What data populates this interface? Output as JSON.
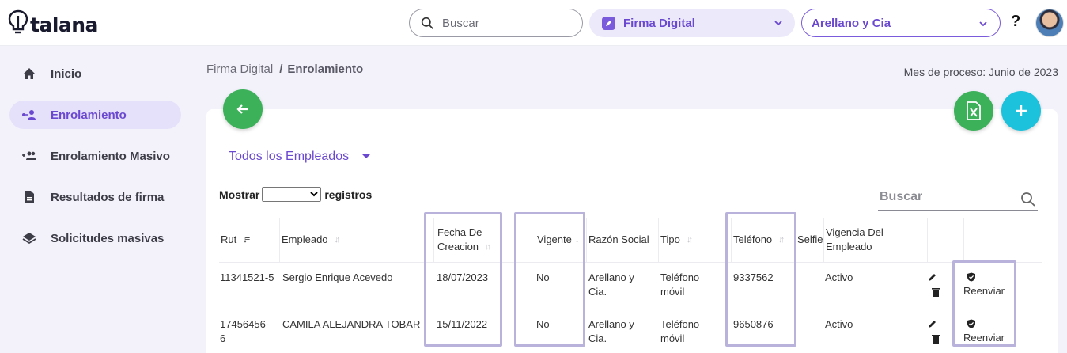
{
  "header": {
    "logo_text": "talana",
    "search_placeholder": "Buscar",
    "module": "Firma Digital",
    "company": "Arellano y Cia",
    "help": "?"
  },
  "sidebar": {
    "items": [
      {
        "label": "Inicio",
        "icon": "home-icon",
        "active": false
      },
      {
        "label": "Enrolamiento",
        "icon": "user-link-icon",
        "active": true
      },
      {
        "label": "Enrolamiento Masivo",
        "icon": "group-add-icon",
        "active": false
      },
      {
        "label": "Resultados de firma",
        "icon": "document-icon",
        "active": false
      },
      {
        "label": "Solicitudes masivas",
        "icon": "layers-icon",
        "active": false
      }
    ]
  },
  "breadcrumb": {
    "parent": "Firma Digital",
    "separator": "/",
    "current": "Enrolamiento"
  },
  "process_month": "Mes de proceso: Junio de 2023",
  "filter": {
    "selected": "Todos los Empleados"
  },
  "table_controls": {
    "show_prefix": "Mostrar",
    "show_suffix": "registros",
    "search_placeholder": "Buscar"
  },
  "table": {
    "columns": [
      {
        "label": "Rut"
      },
      {
        "label": "Empleado"
      },
      {
        "label": "Fecha De Creacion"
      },
      {
        "label": ""
      },
      {
        "label": "Vigente"
      },
      {
        "label": "Razón Social"
      },
      {
        "label": "Tipo"
      },
      {
        "label": "Teléfono"
      },
      {
        "label": "Selfie"
      },
      {
        "label": "Vigencia Del Empleado"
      },
      {
        "label": ""
      },
      {
        "label": ""
      }
    ],
    "rows": [
      {
        "rut": "11341521-5",
        "empleado": "Sergio Enrique Acevedo",
        "fecha": "18/07/2023",
        "vigente": "No",
        "razon_social": "Arellano y Cia.",
        "tipo": "Teléfono móvil",
        "telefono": "9337562",
        "selfie": "",
        "vigencia": "Activo",
        "action": "Reenviar"
      },
      {
        "rut": "17456456-6",
        "empleado": "CAMILA ALEJANDRA TOBAR",
        "fecha": "15/11/2022",
        "vigente": "No",
        "razon_social": "Arellano y Cia.",
        "tipo": "Teléfono móvil",
        "telefono": "9650876",
        "selfie": "",
        "vigencia": "Activo",
        "action": "Reenviar"
      }
    ]
  },
  "colors": {
    "accent": "#6a49d0",
    "green": "#3cb15a",
    "cyan": "#1cc2dc",
    "highlight": "#b9b3dc"
  }
}
